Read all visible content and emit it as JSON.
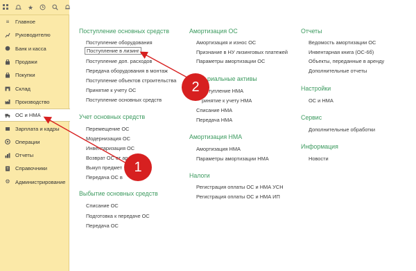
{
  "topbar": {
    "icons": [
      "grid-icon",
      "bell-icon",
      "star-icon",
      "history-icon",
      "search-icon",
      "notification-icon"
    ]
  },
  "sidebar": {
    "items": [
      {
        "label": "Главное",
        "icon": "menu-icon"
      },
      {
        "label": "Руководителю",
        "icon": "chart-icon"
      },
      {
        "label": "Банк и касса",
        "icon": "bank-icon"
      },
      {
        "label": "Продажи",
        "icon": "sales-icon"
      },
      {
        "label": "Покупки",
        "icon": "purchases-icon"
      },
      {
        "label": "Склад",
        "icon": "warehouse-icon"
      },
      {
        "label": "Производство",
        "icon": "production-icon"
      },
      {
        "label": "ОС и НМА",
        "icon": "truck-icon"
      },
      {
        "label": "Зарплата и кадры",
        "icon": "staff-icon"
      },
      {
        "label": "Операции",
        "icon": "operations-icon"
      },
      {
        "label": "Отчеты",
        "icon": "reports-icon"
      },
      {
        "label": "Справочники",
        "icon": "directory-icon"
      },
      {
        "label": "Администрирование",
        "icon": "gear-icon"
      }
    ]
  },
  "columns": {
    "col1": {
      "sections": [
        {
          "title": "Поступление основных средств",
          "links": [
            "Поступление оборудования",
            "Поступление в лизинг",
            "Поступление доп. расходов",
            "Передача оборудования в монтаж",
            "Поступление объектов строительства",
            "Принятие к учету ОС",
            "Поступление основных средств"
          ]
        },
        {
          "title": "Учет основных средств",
          "links": [
            "Перемещение ОС",
            "Модернизация ОС",
            "Инвентаризация ОС",
            "Возврат ОС от ар",
            "Выкуп предмет",
            "Передача ОС в"
          ]
        },
        {
          "title": "Выбытие основных средств",
          "links": [
            "Списание ОС",
            "Подготовка к передаче ОС",
            "Передача ОС"
          ]
        }
      ]
    },
    "col2": {
      "sections": [
        {
          "title": "Амортизация ОС",
          "links": [
            "Амортизация и износ ОС",
            "Признание в НУ лизинговых платежей",
            "Параметры амортизации ОС"
          ]
        },
        {
          "title": "риальные активы",
          "links": [
            "ступление НМА",
            "ринятие к учету НМА",
            "Списание НМА",
            "Передача НМА"
          ]
        },
        {
          "title": "Амортизация НМА",
          "links": [
            "Амортизация НМА",
            "Параметры амортизации НМА"
          ]
        },
        {
          "title": "Налоги",
          "links": [
            "Регистрация оплаты ОС и НМА УСН",
            "Регистрация оплаты ОС и НМА ИП"
          ]
        }
      ]
    },
    "col3": {
      "sections": [
        {
          "title": "Отчеты",
          "links": [
            "Ведомость амортизации ОС",
            "Инвентарная книга (ОС-6б)",
            "Объекты, переданные в аренду",
            "Дополнительные отчеты"
          ]
        },
        {
          "title": "Настройки",
          "links": [
            "ОС и НМА"
          ]
        },
        {
          "title": "Сервис",
          "links": [
            "Дополнительные обработки"
          ]
        },
        {
          "title": "Информация",
          "links": [
            "Новости"
          ]
        }
      ]
    }
  },
  "annotations": {
    "badge1": "1",
    "badge2": "2",
    "color": "#d72020"
  }
}
